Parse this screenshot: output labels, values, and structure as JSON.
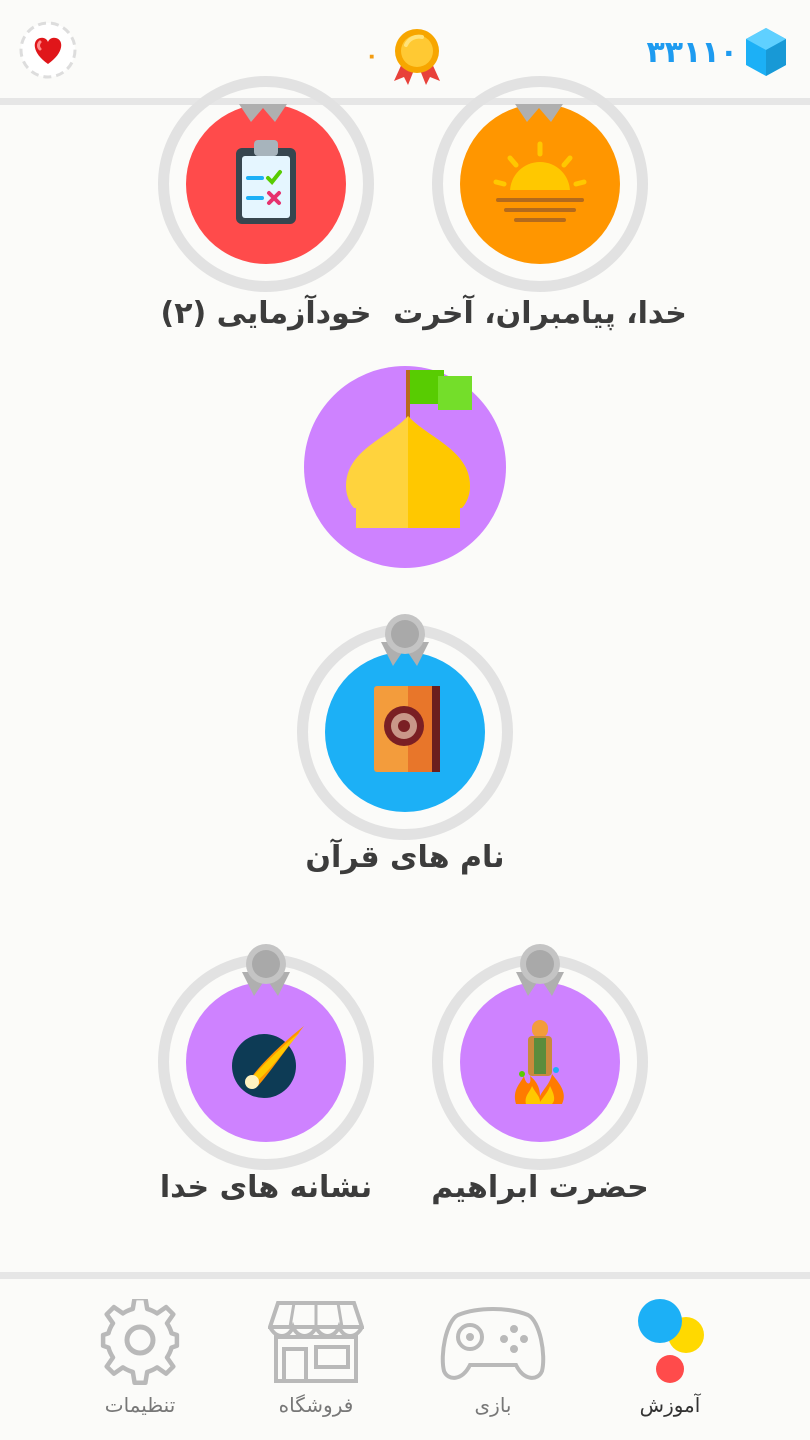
{
  "header": {
    "gems_count": "۳۳۱۱۰",
    "xp_count": "۰"
  },
  "skills": {
    "khoda": {
      "label": "خدا، پیامبران، آخرت",
      "icon": "sunset-icon",
      "color": "#ff9600"
    },
    "khodazmaei": {
      "label": "خودآزمایی (۲)",
      "icon": "clipboard-icon",
      "color": "#ff4b4b"
    },
    "checkpoint": {
      "icon": "mosque-dome-icon",
      "color": "#ce82ff"
    },
    "quran": {
      "label": "نام های قرآن",
      "icon": "quran-book-icon",
      "color": "#1cb0f6"
    },
    "ebrahim": {
      "label": "حضرت ابراهیم",
      "icon": "fire-icon",
      "color": "#ce82ff"
    },
    "neshaneh": {
      "label": "نشانه های خدا",
      "icon": "comet-icon",
      "color": "#ce82ff"
    }
  },
  "tabs": [
    {
      "label": "آموزش",
      "icon": "learn-dots-icon",
      "active": true
    },
    {
      "label": "بازی",
      "icon": "gamepad-icon",
      "active": false
    },
    {
      "label": "فروشگاه",
      "icon": "shop-icon",
      "active": false
    },
    {
      "label": "تنظیمات",
      "icon": "gear-icon",
      "active": false
    }
  ]
}
